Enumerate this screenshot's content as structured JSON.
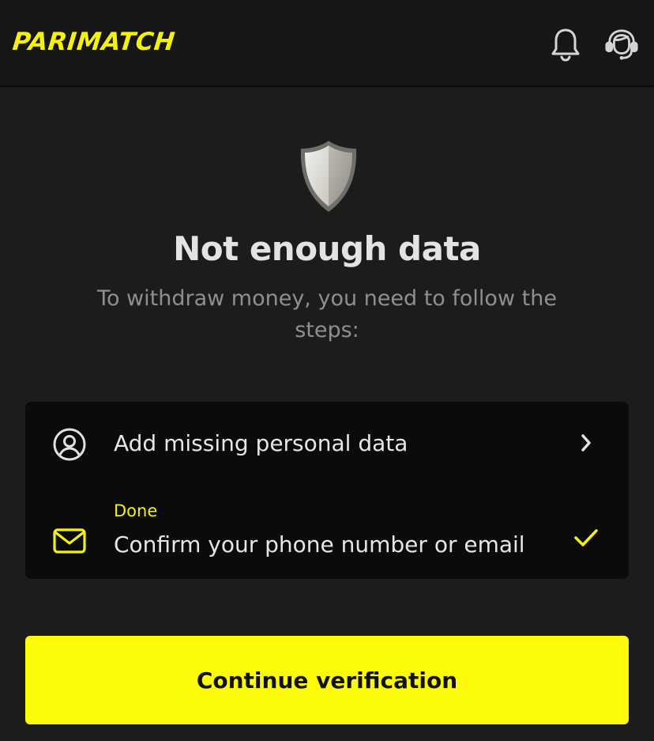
{
  "header": {
    "logo_text": "PARIMATCH",
    "notifications_icon": "bell-icon",
    "support_icon": "headset-icon"
  },
  "main": {
    "illustration_icon": "shield-icon",
    "title": "Not enough data",
    "subtitle": "To withdraw money, you need to follow the steps:",
    "steps": [
      {
        "icon": "user-circle-icon",
        "label": "Add missing personal data",
        "trailing_icon": "chevron-right-icon"
      },
      {
        "icon": "envelope-icon",
        "status": "Done",
        "label": "Confirm your phone number or email",
        "trailing_icon": "check-icon"
      }
    ],
    "cta_label": "Continue verification"
  },
  "colors": {
    "accent": "#f5f10f",
    "background": "#1c1c1c",
    "header_background": "#161616",
    "card_background": "#0b0b0b",
    "cta_background": "#fbfb0a"
  }
}
